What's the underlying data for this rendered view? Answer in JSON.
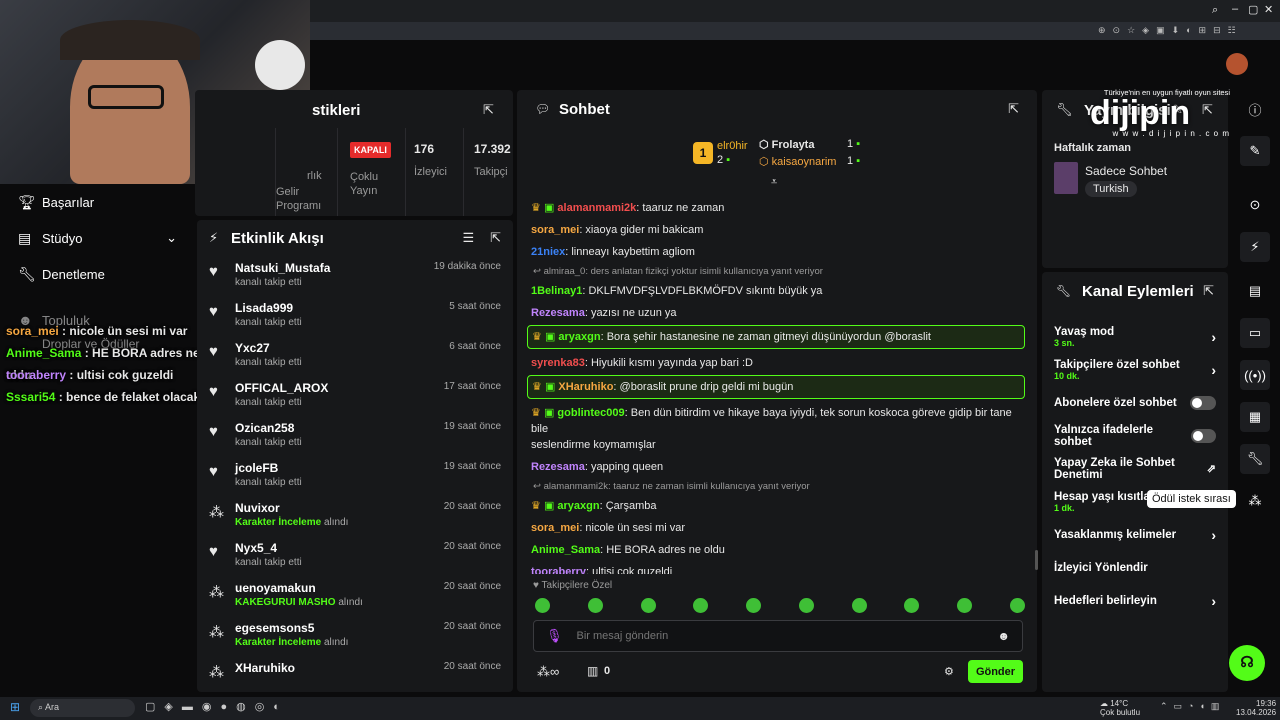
{
  "stats": {
    "title_partial": "stikleri",
    "status_badge": "KAPALI",
    "col1_line1": "Gelir",
    "col1_line2": "Programı",
    "col1_partial": "rlık",
    "col2_line1": "Çoklu",
    "col2_line2": "Yayın",
    "viewers_value": "176",
    "viewers_label": "İzleyici",
    "followers_value": "17.392",
    "followers_label": "Takipçi"
  },
  "left_menu": {
    "items": [
      {
        "label": "Başarılar",
        "icon": "trophy-icon"
      },
      {
        "label": "Stüdyo",
        "icon": "studio-icon"
      },
      {
        "label": "Denetleme",
        "icon": "wrench-icon"
      },
      {
        "label": "Topluluk",
        "icon": "community-icon"
      },
      {
        "label": "Droplar ve Ödüller",
        "icon": "gift-icon"
      }
    ]
  },
  "overlay_chat": [
    {
      "user": "sora_mei",
      "msg": " : nicole ün sesi mi var",
      "color": "#f5a742"
    },
    {
      "user": "Anime_Sama",
      "msg": " : HE BORA adres ne oldu",
      "color": "#53fc18"
    },
    {
      "user": "tooraberry",
      "msg": " : ultisi cok guzeldi",
      "color": "#c084fc"
    },
    {
      "user": "Sssari54",
      "msg": " : bence de felaket olacak",
      "color": "#53fc18"
    }
  ],
  "activity": {
    "title": "Etkinlik Akışı",
    "items": [
      {
        "name": "Natsuki_Mustafa",
        "sub": "kanalı takip etti",
        "time": "19 dakika önce",
        "kind": "follow"
      },
      {
        "name": "Lisada999",
        "sub": "kanalı takip etti",
        "time": "5 saat önce",
        "kind": "follow"
      },
      {
        "name": "Yxc27",
        "sub": "kanalı takip etti",
        "time": "6 saat önce",
        "kind": "follow"
      },
      {
        "name": "OFFICAL_AROX",
        "sub": "kanalı takip etti",
        "time": "17 saat önce",
        "kind": "follow"
      },
      {
        "name": "Ozican258",
        "sub": "kanalı takip etti",
        "time": "19 saat önce",
        "kind": "follow"
      },
      {
        "name": "jcoleFB",
        "sub": "kanalı takip etti",
        "time": "19 saat önce",
        "kind": "follow"
      },
      {
        "name": "Nuvixor",
        "sub_hl": "Karakter İnceleme",
        "sub": " alındı",
        "time": "20 saat önce",
        "kind": "reward"
      },
      {
        "name": "Nyx5_4",
        "sub": "kanalı takip etti",
        "time": "20 saat önce",
        "kind": "follow"
      },
      {
        "name": "uenoyamakun",
        "sub_hl": "KAKEGURUI MASHO",
        "sub": " alındı",
        "time": "20 saat önce",
        "kind": "reward"
      },
      {
        "name": "egesemsons5",
        "sub_hl": "Karakter İnceleme",
        "sub": " alındı",
        "time": "20 saat önce",
        "kind": "reward"
      },
      {
        "name": "XHaruhiko",
        "sub": "",
        "time": "20 saat önce",
        "kind": "reward"
      }
    ]
  },
  "chat": {
    "title": "Sohbet",
    "leaderboard": {
      "first": "elr0hir",
      "first_count": "2",
      "rank": "1",
      "second": "Frolayta",
      "second_count": "1",
      "third": "kaisaoynarim",
      "third_count": "1"
    },
    "messages": [
      {
        "type": "msg",
        "user": "alamanmami2k",
        "color": "#f24e4e",
        "text": ": taaruz ne zaman",
        "badges": true
      },
      {
        "type": "msg",
        "user": "sora_mei",
        "color": "#f5a742",
        "text": ": xiaoya gider mi bakicam"
      },
      {
        "type": "msg",
        "user": "21niex",
        "color": "#3b82f6",
        "text": ": linneayı kaybettim agliom"
      },
      {
        "type": "reply",
        "text": "almiraa_0: ders anlatan fizikçi yoktur isimli kullanıcıya yanıt veriyor"
      },
      {
        "type": "msg",
        "user": "1Belinay1",
        "color": "#53fc18",
        "text": ": DKLFMVDFŞLVDFLBKMÖFDV sıkıntı büyük ya"
      },
      {
        "type": "msg",
        "user": "Rezesama",
        "color": "#c084fc",
        "text": ": yazısı ne uzun ya"
      },
      {
        "type": "hl",
        "user": "aryaxgn",
        "color": "#53fc18",
        "text": ": Bora şehir hastanesine ne zaman gitmeyi düşünüyordun @boraslit",
        "badges": true
      },
      {
        "type": "msg",
        "user": "syrenka83",
        "color": "#f24e4e",
        "text": ": Hiyukili kısmı yayında yap bari :D"
      },
      {
        "type": "hl",
        "user": "XHaruhiko",
        "color": "#f5a742",
        "text": ": @boraslit prune drip geldi mi bugün",
        "badges": true
      },
      {
        "type": "msg2",
        "user": "goblintec009",
        "color": "#53fc18",
        "text": ": Ben dün bitirdim ve hikaye baya iyiydi, tek sorun koskoca göreve gidip bir tane bile",
        "text2": "seslendirme koymamışlar",
        "badges": true
      },
      {
        "type": "msg",
        "user": "Rezesama",
        "color": "#c084fc",
        "text": ": yapping queen"
      },
      {
        "type": "reply",
        "text": "alamanmami2k: taaruz ne zaman isimli kullanıcıya yanıt veriyor"
      },
      {
        "type": "msg",
        "user": "aryaxgn",
        "color": "#53fc18",
        "text": ": Çarşamba",
        "badges": true
      },
      {
        "type": "msg",
        "user": "sora_mei",
        "color": "#f5a742",
        "text": ": nicole ün sesi mi var"
      },
      {
        "type": "msg",
        "user": "Anime_Sama",
        "color": "#53fc18",
        "text": ": HE BORA adres ne oldu"
      },
      {
        "type": "msg",
        "user": "tooraberry",
        "color": "#c084fc",
        "text": ": ultisi cok guzeldi"
      },
      {
        "type": "msg",
        "user": "Sssari54",
        "color": "#53fc18",
        "text": ": bence de felaket olacak"
      }
    ],
    "followers_only": "Takipçilere Özel",
    "input_placeholder": "Bir mesaj gönderin",
    "points": "0",
    "send_label": "Gönder"
  },
  "info": {
    "title": "Yayın bilgisi",
    "weekly": "Haftalık zaman",
    "category": "Sadece Sohbet",
    "tag": "Turkish"
  },
  "watermark": {
    "top": "Türkiye'nin en uygun fiyatlı oyun sitesi",
    "brand": "dijipin",
    "url": "w w w . d i j i p i n . c o m"
  },
  "actions": {
    "title": "Kanal Eylemleri",
    "items": [
      {
        "label": "Yavaş mod",
        "sub": "3 sn.",
        "ctrl": "chev"
      },
      {
        "label": "Takipçilere özel sohbet",
        "sub": "10 dk.",
        "ctrl": "chev"
      },
      {
        "label": "Abonelere özel sohbet",
        "sub": "",
        "ctrl": "toggle"
      },
      {
        "label": "Yalnızca ifadelerle sohbet",
        "sub": "",
        "ctrl": "toggle"
      },
      {
        "label": "Yapay Zeka ile Sohbet",
        "label2": "Denetimi",
        "sub": "",
        "ctrl": "ext"
      },
      {
        "label": "Hesap yaşı kısıtlam",
        "sub": "1 dk.",
        "ctrl": "none"
      },
      {
        "label": "Yasaklanmış kelimeler",
        "sub": "",
        "ctrl": "chev"
      },
      {
        "label": "İzleyici Yönlendir",
        "sub": "",
        "ctrl": "none"
      },
      {
        "label": "Hedefleri belirleyin",
        "sub": "",
        "ctrl": "chev"
      }
    ],
    "tooltip": "Ödül istek sırası"
  },
  "taskbar": {
    "search": "Ara",
    "weather_temp": "14°C",
    "weather_desc": "Çok bulutlu",
    "time": "19:36",
    "date": "13.04.2026"
  }
}
